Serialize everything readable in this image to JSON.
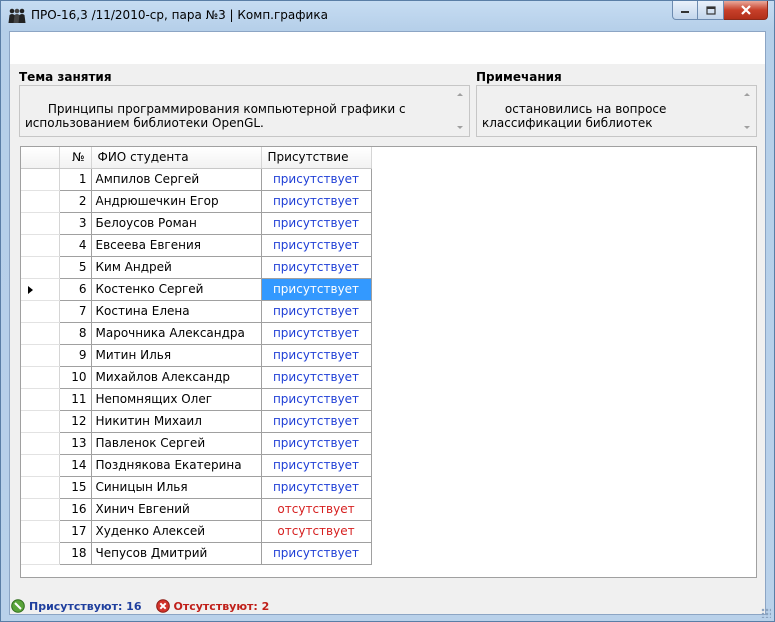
{
  "window": {
    "title": "ПРО-16,3 /11/2010-ср, пара №3 | Комп.графика"
  },
  "topic": {
    "label": "Тема занятия",
    "value": "Принципы программирования компьютерной графики с использованием библиотеки OpenGL."
  },
  "notes": {
    "label": "Примечания",
    "value": "остановились на вопросе классификации библиотек"
  },
  "grid": {
    "columns": {
      "num": "№",
      "name": "ФИО студента",
      "presence": "Присутствие"
    },
    "rows": [
      {
        "num": "1",
        "name": "Ампилов Сергей",
        "status": "присутствует",
        "present": true
      },
      {
        "num": "2",
        "name": "Андрюшечкин Егор",
        "status": "присутствует",
        "present": true
      },
      {
        "num": "3",
        "name": "Белоусов Роман",
        "status": "присутствует",
        "present": true
      },
      {
        "num": "4",
        "name": "Евсеева Евгения",
        "status": "присутствует",
        "present": true
      },
      {
        "num": "5",
        "name": "Ким Андрей",
        "status": "присутствует",
        "present": true
      },
      {
        "num": "6",
        "name": "Костенко Сергей",
        "status": "присутствует",
        "present": true,
        "selected": true
      },
      {
        "num": "7",
        "name": "Костина Елена",
        "status": "присутствует",
        "present": true
      },
      {
        "num": "8",
        "name": "Марочника Александра",
        "status": "присутствует",
        "present": true
      },
      {
        "num": "9",
        "name": "Митин Илья",
        "status": "присутствует",
        "present": true
      },
      {
        "num": "10",
        "name": "Михайлов Александр",
        "status": "присутствует",
        "present": true
      },
      {
        "num": "11",
        "name": "Непомнящих Олег",
        "status": "присутствует",
        "present": true
      },
      {
        "num": "12",
        "name": "Никитин Михаил",
        "status": "присутствует",
        "present": true
      },
      {
        "num": "13",
        "name": "Павленок Сергей",
        "status": "присутствует",
        "present": true
      },
      {
        "num": "14",
        "name": "Позднякова Екатерина",
        "status": "присутствует",
        "present": true
      },
      {
        "num": "15",
        "name": "Синицын Илья",
        "status": "присутствует",
        "present": true
      },
      {
        "num": "16",
        "name": "Хинич Евгений",
        "status": "отсутствует",
        "present": false
      },
      {
        "num": "17",
        "name": "Худенко Алексей",
        "status": "отсутствует",
        "present": false
      },
      {
        "num": "18",
        "name": "Чепусов Дмитрий",
        "status": "присутствует",
        "present": true
      }
    ]
  },
  "status": {
    "present_text": "Присутствуют: 16",
    "absent_text": "Отсутствуют: 2"
  },
  "colors": {
    "present": "#1f3fd6",
    "absent": "#d61f1f",
    "selection": "#3399ff"
  },
  "icons": [
    "people-icon",
    "minimize-icon",
    "maximize-icon",
    "close-icon",
    "check-icon",
    "cross-icon"
  ]
}
